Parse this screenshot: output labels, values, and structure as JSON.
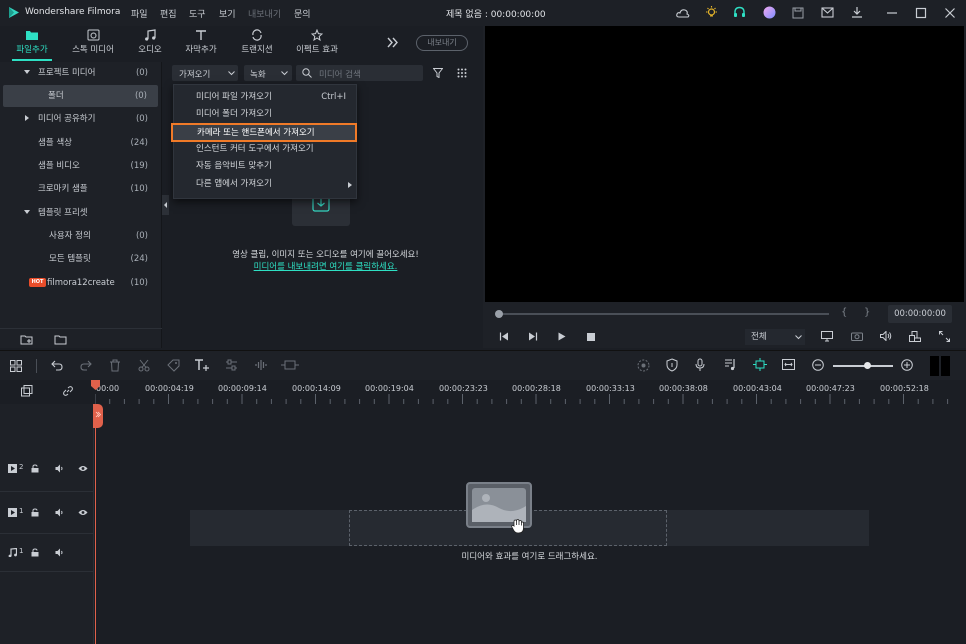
{
  "app": {
    "title": "Wondershare Filmora",
    "menus": [
      "파일",
      "편집",
      "도구",
      "보기",
      "내보내기",
      "문의"
    ],
    "doc_title": "제목 없음 : 00:00:00:00"
  },
  "toolbar": {
    "tabs": [
      "파일추가",
      "스톡 미디어",
      "오디오",
      "자막추가",
      "트랜지션",
      "이펙트 효과"
    ],
    "export": "내보내기"
  },
  "library": [
    {
      "label": "프로젝트 미디어",
      "count": "(0)"
    },
    {
      "label": "폴더",
      "count": "(0)"
    },
    {
      "label": "미디어 공유하기",
      "count": "(0)"
    },
    {
      "label": "샘플 색상",
      "count": "(24)"
    },
    {
      "label": "샘플 비디오",
      "count": "(19)"
    },
    {
      "label": "크로마키 샘플",
      "count": "(10)"
    },
    {
      "label": "템플릿 프리셋",
      "count": ""
    },
    {
      "label": "사용자 정의",
      "count": "(0)"
    },
    {
      "label": "모든 템플릿",
      "count": "(24)"
    },
    {
      "label": "filmora12create",
      "count": "(10)"
    }
  ],
  "hot_badge": "HOT",
  "media": {
    "import_label": "가져오기",
    "record_label": "녹화",
    "search_placeholder": "미디어 검색",
    "drop_text": "영상 클립, 이미지 또는 오디오를 여기에 끌어오세요!",
    "link_text": "미디어를 내보내려면 여기를 클릭하세요."
  },
  "import_menu": [
    {
      "label": "미디어 파일 가져오기",
      "shortcut": "Ctrl+I"
    },
    {
      "label": "미디어 폴더 가져오기",
      "shortcut": ""
    },
    {
      "label": "카메라 또는 핸드폰에서 가져오기",
      "shortcut": ""
    },
    {
      "label": "인스턴트 커터 도구에서 가져오기",
      "shortcut": ""
    },
    {
      "label": "자동 음악비트 맞추기",
      "shortcut": ""
    },
    {
      "label": "다른 앱에서 가져오기",
      "shortcut": ""
    }
  ],
  "preview": {
    "timecode": "00:00:00:00",
    "quality": "전체",
    "brace_open": "{",
    "brace_close": "}"
  },
  "ruler": [
    "00:00",
    "00:00:04:19",
    "00:00:09:14",
    "00:00:14:09",
    "00:00:19:04",
    "00:00:23:23",
    "00:00:28:18",
    "00:00:33:13",
    "00:00:38:08",
    "00:00:43:04",
    "00:00:47:23",
    "00:00:52:18"
  ],
  "tracks": [
    {
      "num": "2"
    },
    {
      "num": "1"
    },
    {
      "num": "1"
    }
  ],
  "timeline": {
    "drop_text": "미디어와 효과를 여기로 드래그하세요."
  },
  "colors": {
    "accent": "#2ee0c4",
    "highlight": "#f07a28",
    "playhead": "#e0614b"
  }
}
